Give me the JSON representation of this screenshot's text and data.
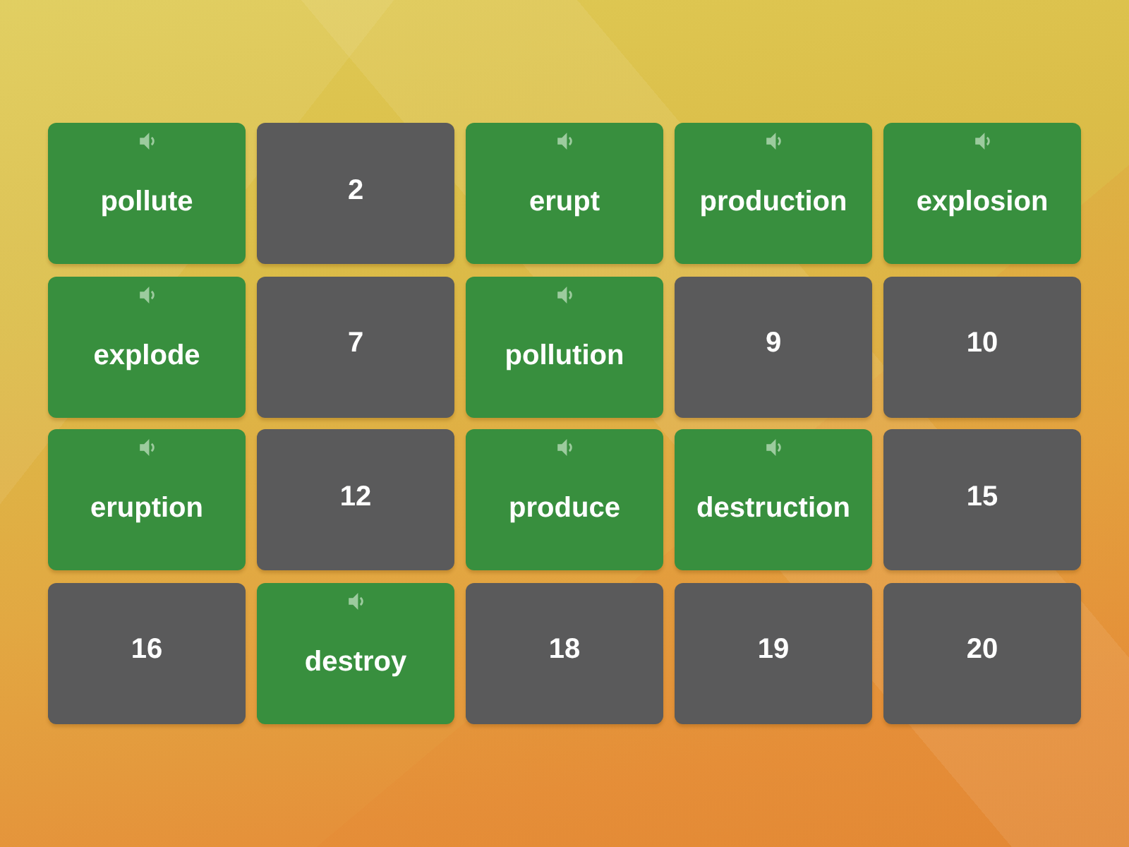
{
  "tiles": [
    {
      "kind": "word",
      "label": "pollute"
    },
    {
      "kind": "number",
      "label": "2"
    },
    {
      "kind": "word",
      "label": "erupt"
    },
    {
      "kind": "word",
      "label": "production"
    },
    {
      "kind": "word",
      "label": "explosion"
    },
    {
      "kind": "word",
      "label": "explode"
    },
    {
      "kind": "number",
      "label": "7"
    },
    {
      "kind": "word",
      "label": "pollution"
    },
    {
      "kind": "number",
      "label": "9"
    },
    {
      "kind": "number",
      "label": "10"
    },
    {
      "kind": "word",
      "label": "eruption"
    },
    {
      "kind": "number",
      "label": "12"
    },
    {
      "kind": "word",
      "label": "produce"
    },
    {
      "kind": "word",
      "label": "destruction"
    },
    {
      "kind": "number",
      "label": "15"
    },
    {
      "kind": "number",
      "label": "16"
    },
    {
      "kind": "word",
      "label": "destroy"
    },
    {
      "kind": "number",
      "label": "18"
    },
    {
      "kind": "number",
      "label": "19"
    },
    {
      "kind": "number",
      "label": "20"
    }
  ]
}
